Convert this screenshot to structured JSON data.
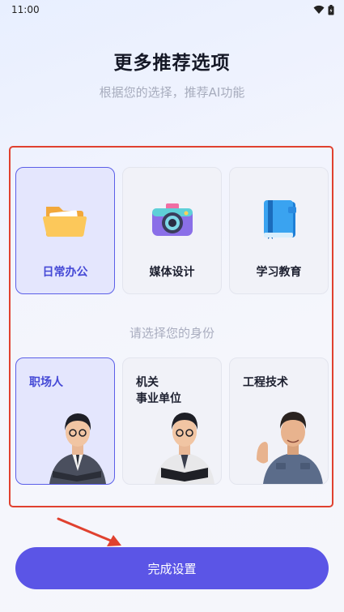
{
  "status_bar": {
    "time": "11:00"
  },
  "header": {
    "title": "更多推荐选项",
    "subtitle": "根据您的选择，推荐AI功能"
  },
  "categories": [
    {
      "label": "日常办公",
      "icon": "folder-icon",
      "selected": true
    },
    {
      "label": "媒体设计",
      "icon": "camera-icon",
      "selected": false
    },
    {
      "label": "学习教育",
      "icon": "notebook-icon",
      "selected": false
    }
  ],
  "identity_hint": "请选择您的身份",
  "roles": [
    {
      "label": "职场人",
      "icon": "office-worker-avatar",
      "selected": true
    },
    {
      "label_line1": "机关",
      "label_line2": "事业单位",
      "icon": "government-worker-avatar",
      "selected": false
    },
    {
      "label": "工程技术",
      "icon": "engineer-avatar",
      "selected": false
    }
  ],
  "finish_button": {
    "label": "完成设置"
  },
  "colors": {
    "accent": "#5b55e6",
    "highlight": "#e0412f",
    "selected_bg": "#e4e6fd"
  }
}
